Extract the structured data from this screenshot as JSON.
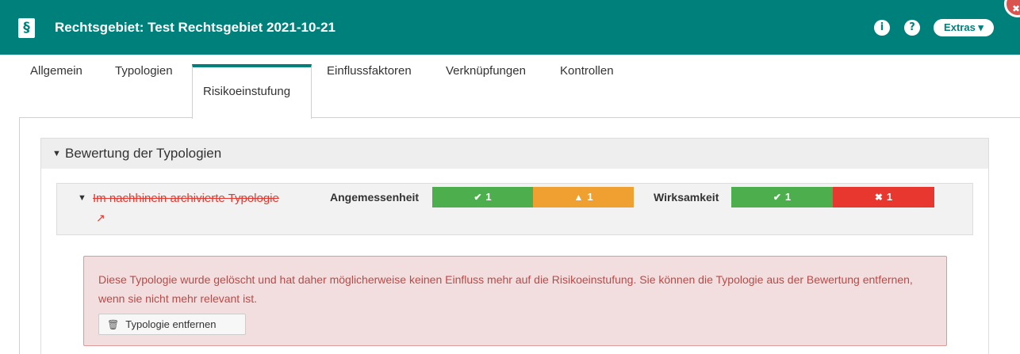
{
  "header": {
    "logo_glyph": "§",
    "title": "Rechtsgebiet: Test Rechtsgebiet 2021-10-21",
    "info_icon": "i",
    "help_icon": "?",
    "extras_label": "Extras ▾",
    "close_glyph": "✖",
    "color": "#00807a"
  },
  "tabs": [
    {
      "label": "Allgemein"
    },
    {
      "label": "Typologien"
    },
    {
      "label": "Risikoeinstufung",
      "active": true
    },
    {
      "label": "Einflussfaktoren"
    },
    {
      "label": "Verknüpfungen"
    },
    {
      "label": "Kontrollen"
    }
  ],
  "section": {
    "caret": "▼",
    "title": "Bewertung der Typologien"
  },
  "typology": {
    "caret": "▼",
    "name": "Im nachhinein archivierte Typologie",
    "external_icon": "↗",
    "angemessenheit_label": "Angemessenheit",
    "angemessenheit": [
      {
        "icon": "check-circle-icon",
        "glyph": "✔",
        "count": "1",
        "color": "#4cae4c"
      },
      {
        "icon": "warning-icon",
        "glyph": "▲",
        "count": "1",
        "color": "#f0a030"
      }
    ],
    "wirksamkeit_label": "Wirksamkeit",
    "wirksamkeit": [
      {
        "icon": "check-circle-icon",
        "glyph": "✔",
        "count": "1",
        "color": "#4cae4c"
      },
      {
        "icon": "times-circle-icon",
        "glyph": "✖",
        "count": "1",
        "color": "#e8372e"
      }
    ]
  },
  "alert": {
    "text": "Diese Typologie wurde gelöscht und hat daher möglicherweise keinen Einfluss mehr auf die Risikoeinstufung. Sie können die Typologie aus der Bewertung entfernen, wenn sie nicht mehr relevant ist.",
    "button_icon": "🗑",
    "button_label": "Typologie entfernen"
  }
}
